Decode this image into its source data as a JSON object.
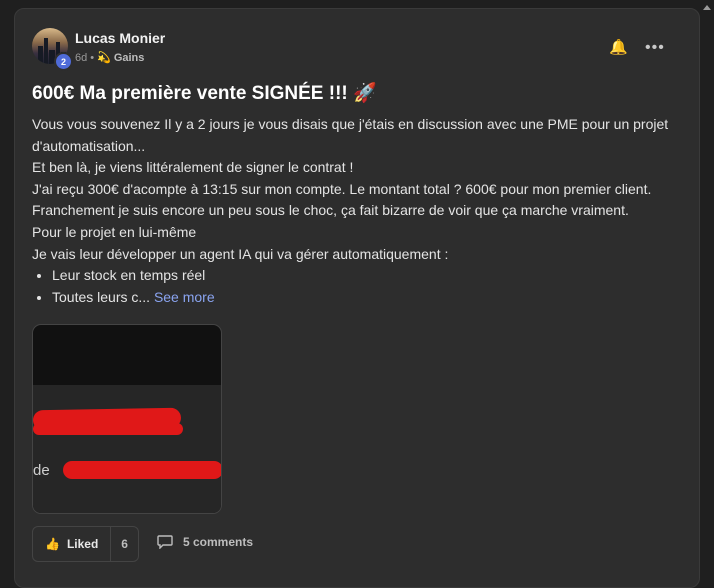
{
  "post": {
    "author": "Lucas Monier",
    "level": "2",
    "time": "6d",
    "separator": "•",
    "category_icon": "💫",
    "category": "Gains",
    "title": "600€ Ma première vente SIGNÉE !!! 🚀",
    "body_lines": [
      "Vous vous souvenez Il y a 2 jours je vous disais que j'étais en discussion avec une PME pour un projet d'automatisation...",
      "Et ben là, je viens littéralement de signer le contrat !",
      "J'ai reçu 300€ d'acompte à 13:15 sur mon compte. Le montant total ? 600€ pour mon premier client.",
      "Franchement je suis encore un peu sous le choc, ça fait bizarre de voir que ça marche vraiment.",
      "Pour le projet en lui-même",
      "Je vais leur développer un agent IA qui va gérer automatiquement :"
    ],
    "bullets": [
      "Leur stock en temps réel",
      "Toutes leurs c..."
    ],
    "see_more": "See more",
    "image_text": "de"
  },
  "actions": {
    "like_label": "Liked",
    "like_icon": "👍",
    "like_count": "6",
    "comments_label": "5 comments"
  },
  "icons": {
    "bell": "🔔",
    "more": "•••"
  },
  "colors": {
    "accent_link": "#8aa4f0",
    "badge": "#4f6bd8",
    "bell": "#f2c21a"
  }
}
